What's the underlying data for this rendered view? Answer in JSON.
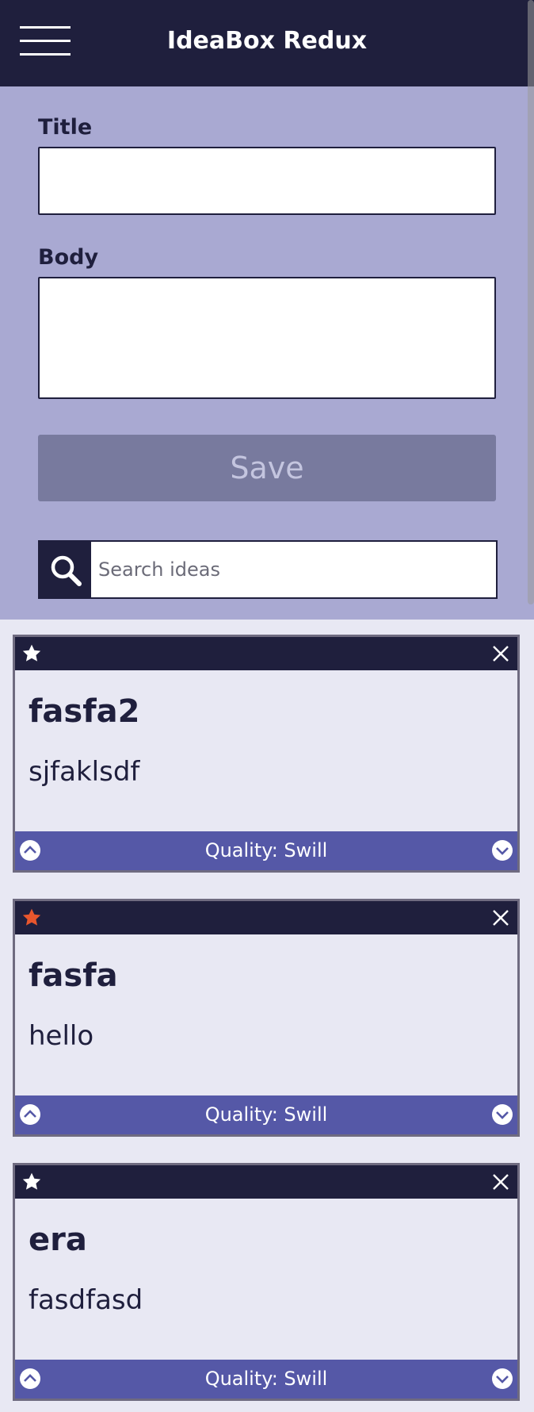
{
  "header": {
    "title": "IdeaBox Redux",
    "menu_icon": "hamburger-menu-icon"
  },
  "form": {
    "title_label": "Title",
    "title_value": "",
    "body_label": "Body",
    "body_value": "",
    "save_label": "Save",
    "search_placeholder": "Search ideas",
    "search_icon": "magnifier-icon"
  },
  "ideas": [
    {
      "title": "fasfa2",
      "body": "sjfaklsdf",
      "quality": "Quality: Swill",
      "starred": false
    },
    {
      "title": "fasfa",
      "body": "hello",
      "quality": "Quality: Swill",
      "starred": true
    },
    {
      "title": "era",
      "body": "fasdfasd",
      "quality": "Quality: Swill",
      "starred": false
    }
  ],
  "colors": {
    "header": "#1f1f3d",
    "form_bg": "#a9a9d2",
    "save_button": "#787a9e",
    "card_footer": "#5558a7",
    "star_active": "#e8562d",
    "star_inactive": "#ffffff"
  }
}
